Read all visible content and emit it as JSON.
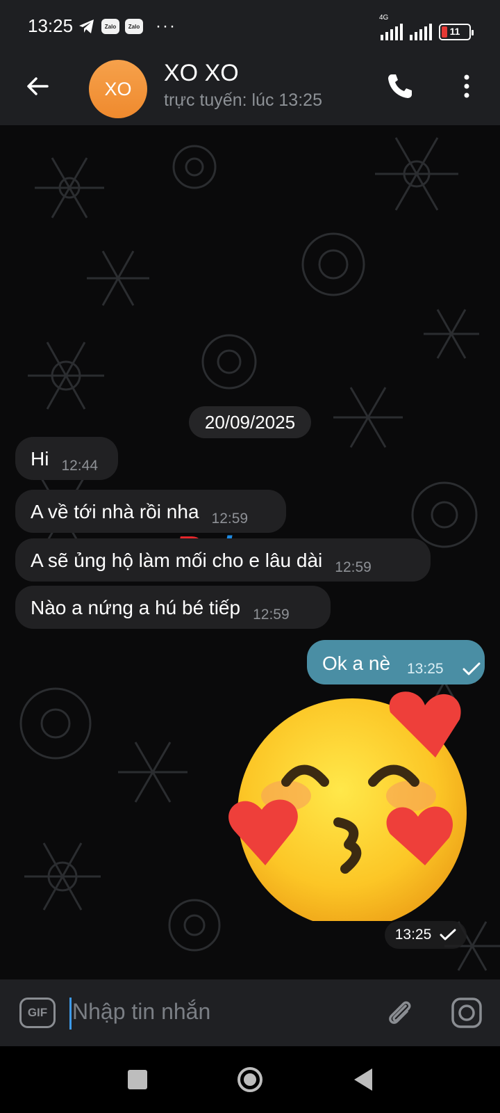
{
  "status_bar": {
    "time": "13:25",
    "app_icons": [
      "telegram-icon",
      "zalo-icon",
      "zalo-icon"
    ],
    "zalo_label": "Zalo",
    "more_label": "···",
    "network_label": "4G",
    "battery_level": "11"
  },
  "header": {
    "avatar_initials": "XO",
    "avatar_color": "#f39a3e",
    "title": "XO XO",
    "subtitle": "trực tuyến: lúc 13:25"
  },
  "chat": {
    "date": "20/09/2025",
    "incoming": [
      {
        "text": "Hi",
        "time": "12:44"
      },
      {
        "text": "A về tới nhà rồi nha",
        "time": "12:59"
      },
      {
        "text": "A sẽ ủng hộ làm mối cho e lâu dài",
        "time": "12:59"
      },
      {
        "text": "Nào a nứng a hú bé tiếp",
        "time": "12:59"
      }
    ],
    "outgoing": {
      "text": "Ok a nè",
      "time": "13:25"
    },
    "sticker": {
      "emoji": "kissing-face-with-hearts",
      "time": "13:25"
    },
    "outgoing_bubble_color": "#4a8ea4"
  },
  "watermark": {
    "part1": "R",
    "part2": "phang"
  },
  "input": {
    "placeholder": "Nhập tin nhắn",
    "gif_label": "GIF"
  }
}
